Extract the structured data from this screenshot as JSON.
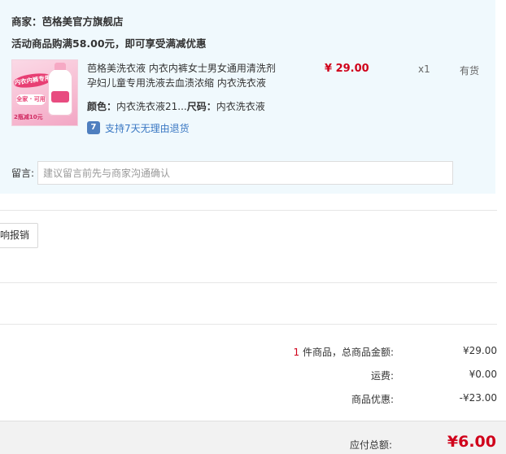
{
  "store": {
    "label": "商家：",
    "name": "芭格美官方旗舰店"
  },
  "promo": {
    "text": "活动商品购满58.00元，即可享受满减优惠"
  },
  "product": {
    "title": "芭格美洗衣液 内衣内裤女士男女通用清洗剂孕妇儿童专用洗液去血渍浓缩 内衣洗衣液",
    "price": "¥ 29.00",
    "quantity": "x1",
    "stock": "有货",
    "color_label": "颜色：",
    "color_value": "内衣洗衣液21...",
    "size_label": "尺码：",
    "size_value": "内衣洗衣液",
    "thumbnail_texts": {
      "badge": "内衣内裤专用",
      "tag": "全家 · 可用",
      "foot": "2瓶减10元"
    }
  },
  "return_policy": {
    "icon": "return-7day-icon",
    "icon_glyph": "7",
    "text": "支持7天无理由退货"
  },
  "message": {
    "label": "留言:",
    "placeholder": "建议留言前先与商家沟通确认"
  },
  "reimburse_button": {
    "label": "响报销"
  },
  "summary": {
    "count": "1",
    "count_suffix": " 件商品，总商品金额:",
    "goods_total": "¥29.00",
    "shipping_label": "运费:",
    "shipping_value": "¥0.00",
    "discount_label": "商品优惠:",
    "discount_value": "-¥23.00",
    "total_label": "应付总额:",
    "total_value": "¥6.00"
  },
  "colors": {
    "accent_red": "#d0021b",
    "panel_bg": "#f0f9fd",
    "link_blue": "#3a78c3"
  }
}
